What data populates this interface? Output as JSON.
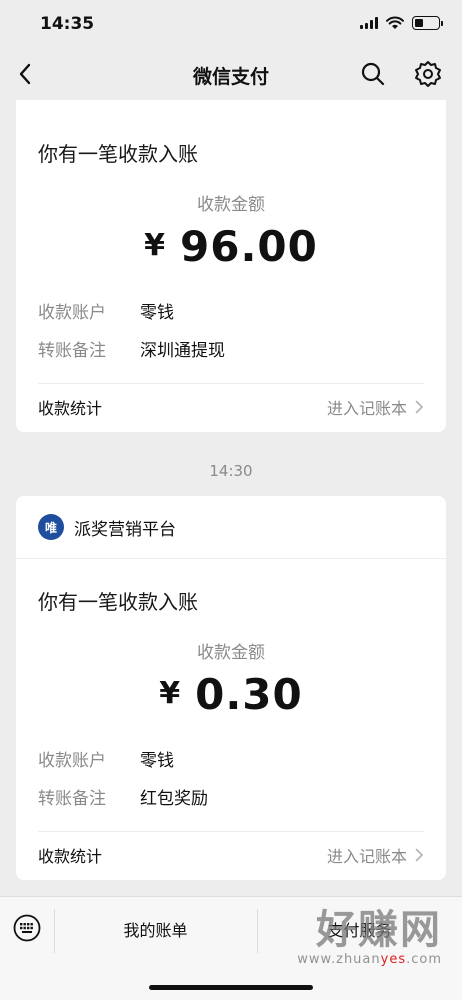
{
  "status_bar": {
    "time": "14:35",
    "icons": [
      "signal-icon",
      "wifi-icon",
      "battery-icon"
    ],
    "battery_level": 0.35
  },
  "nav": {
    "title": "微信支付",
    "back_icon": "chevron-left-icon",
    "search_icon": "search-icon",
    "settings_icon": "gear-icon"
  },
  "messages": [
    {
      "heading": "你有一笔收款入账",
      "amount_label": "收款金额",
      "currency_symbol": "¥",
      "amount": "96.00",
      "details": [
        {
          "key": "收款账户",
          "value": "零钱"
        },
        {
          "key": "转账备注",
          "value": "深圳通提现"
        }
      ],
      "stats_label": "收款统计",
      "stats_link": "进入记账本"
    },
    {
      "timestamp": "14:30",
      "merchant": {
        "logo_text": "唯",
        "name": "派奖营销平台"
      },
      "heading": "你有一笔收款入账",
      "amount_label": "收款金额",
      "currency_symbol": "¥",
      "amount": "0.30",
      "details": [
        {
          "key": "收款账户",
          "value": "零钱"
        },
        {
          "key": "转账备注",
          "value": "红包奖励"
        }
      ],
      "stats_label": "收款统计",
      "stats_link": "进入记账本"
    }
  ],
  "bottom_bar": {
    "keyboard_icon": "keyboard-icon",
    "items": [
      "我的账单",
      "支付服务"
    ]
  },
  "watermark": {
    "text": "好赚网",
    "url_parts": [
      "www.zhuan",
      "yes",
      ".com"
    ]
  },
  "colors": {
    "background": "#ededed",
    "card": "#ffffff",
    "merchant_logo": "#1e4e9c",
    "secondary_text": "#8a8a8a"
  }
}
